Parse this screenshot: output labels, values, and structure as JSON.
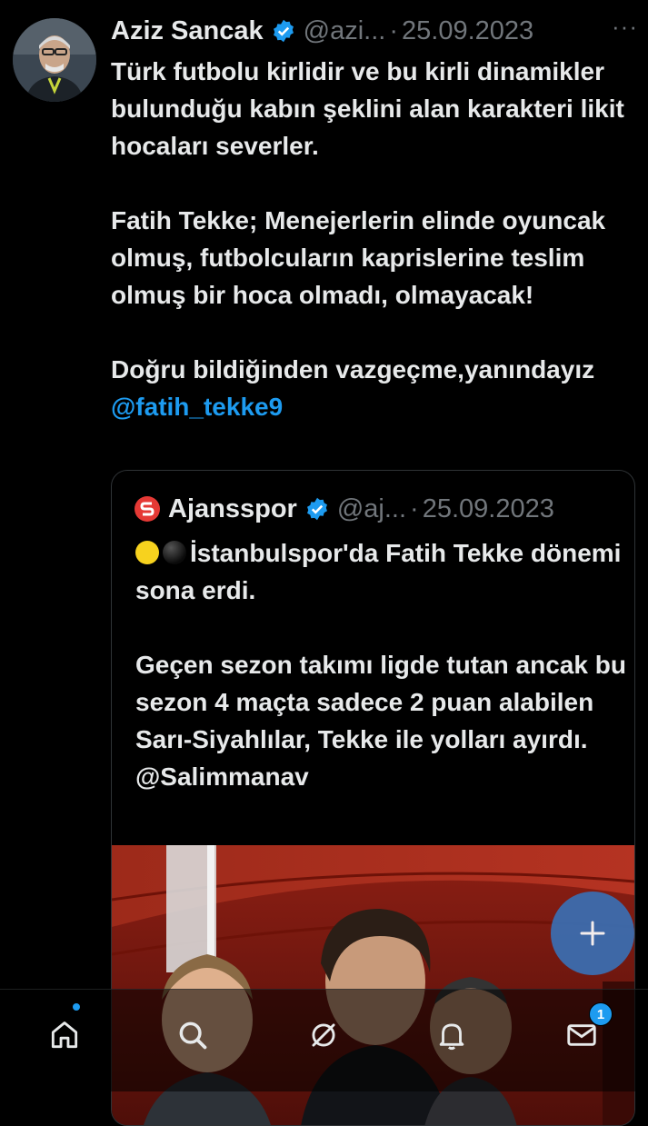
{
  "tweet": {
    "author_name": "Aziz Sancak",
    "author_handle": "@azi...",
    "separator": "·",
    "date": "25.09.2023",
    "more_label": "···",
    "paragraph1": "Türk futbolu kirlidir ve bu kirli dinamikler bulunduğu kabın şeklini alan karakteri likit hocaları severler.",
    "paragraph2": "Fatih Tekke; Menejerlerin elinde oyuncak olmuş, futbolcuların kaprislerine teslim olmuş bir hoca olmadı, olmayacak!",
    "paragraph3_text": "Doğru bildiğinden vazgeçme,yanındayız ",
    "paragraph3_mention": "@fatih_tekke9"
  },
  "quote": {
    "author_name": "Ajansspor",
    "author_handle": "@aj...",
    "separator": "·",
    "date": "25.09.2023",
    "line1": "İstanbulspor'da Fatih Tekke dönemi sona erdi.",
    "paragraph2": "Geçen sezon takımı ligde tutan ancak bu sezon 4 maçta sadece 2 puan alabilen Sarı-Siyahlılar, Tekke ile yolları ayırdı.",
    "mention": "@Salimmanav"
  },
  "nav": {
    "items": [
      "home-icon",
      "search-icon",
      "grok-icon",
      "notifications-icon",
      "messages-icon"
    ],
    "messages_badge": "1"
  },
  "colors": {
    "background": "#000000",
    "text": "#e7e9ea",
    "muted": "#71767b",
    "accent": "#1d9bf0",
    "border": "#2f3336"
  }
}
